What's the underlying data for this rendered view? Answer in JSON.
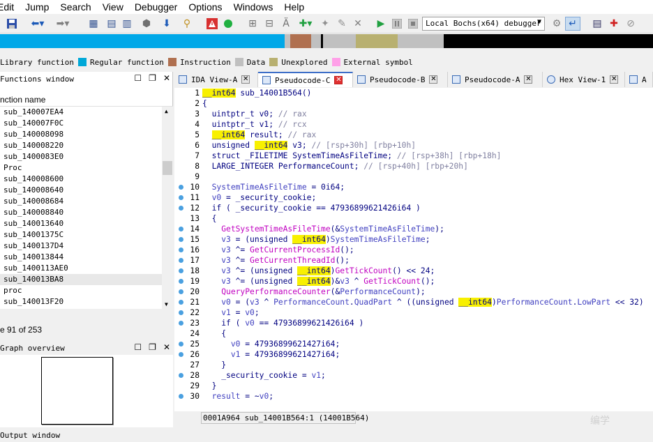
{
  "menu": [
    "Edit",
    "Jump",
    "Search",
    "View",
    "Debugger",
    "Options",
    "Windows",
    "Help"
  ],
  "debugger_select": "Local Bochs(x64) debugger",
  "legend": [
    {
      "label": "Library function",
      "color": "#00a8d8"
    },
    {
      "label": "Regular function",
      "color": "#b07050"
    },
    {
      "label": "Instruction",
      "color": "#c0c0c0"
    },
    {
      "label": "Data",
      "color": "#b8b070"
    },
    {
      "label": "Unexplored",
      "color": "#ffa0e8"
    },
    {
      "label": "External symbol",
      "color": ""
    }
  ],
  "functions_window": {
    "title": "Functions window",
    "column": "nction name",
    "rows": [
      "sub_140007EA4",
      "sub_140007F0C",
      "sub_140008098",
      "sub_140008220",
      "sub_1400083E0",
      "Proc",
      "sub_140008600",
      "sub_140008640",
      "sub_140008684",
      "sub_140008840",
      "sub_140013640",
      "sub_14001375C",
      "sub_1400137D4",
      "sub_140013844",
      "sub_1400113AE0",
      "sub_140013BA8",
      "proc",
      "sub_140013F20"
    ],
    "status": "e 91 of 253"
  },
  "graph_overview": {
    "title": "Graph overview"
  },
  "output_window": {
    "title": "Output window"
  },
  "tabs": [
    {
      "label": "IDA View-A"
    },
    {
      "label": "Pseudocode-C"
    },
    {
      "label": "Pseudocode-B"
    },
    {
      "label": "Pseudocode-A"
    },
    {
      "label": "Hex View-1"
    },
    {
      "label": "A"
    }
  ],
  "code_lines": [
    {
      "n": "1",
      "t": "__int64 sub_14001B564()"
    },
    {
      "n": "2",
      "t": "{"
    },
    {
      "n": "3",
      "t": "  uintptr_t v0; // rax"
    },
    {
      "n": "4",
      "t": "  uintptr_t v1; // rcx"
    },
    {
      "n": "5",
      "t": "  __int64 result; // rax"
    },
    {
      "n": "6",
      "t": "  unsigned __int64 v3; // [rsp+30h] [rbp+10h]"
    },
    {
      "n": "7",
      "t": "  struct _FILETIME SystemTimeAsFileTime; // [rsp+38h] [rbp+18h]"
    },
    {
      "n": "8",
      "t": "  LARGE_INTEGER PerformanceCount; // [rsp+40h] [rbp+20h]"
    },
    {
      "n": "9",
      "t": ""
    },
    {
      "n": "10",
      "t": "  SystemTimeAsFileTime = 0i64;"
    },
    {
      "n": "11",
      "t": "  v0 = _security_cookie;"
    },
    {
      "n": "12",
      "t": "  if ( _security_cookie == 47936899621426i64 )"
    },
    {
      "n": "13",
      "t": "  {"
    },
    {
      "n": "14",
      "t": "    GetSystemTimeAsFileTime(&SystemTimeAsFileTime);"
    },
    {
      "n": "15",
      "t": "    v3 = (unsigned __int64)SystemTimeAsFileTime;"
    },
    {
      "n": "16",
      "t": "    v3 ^= GetCurrentProcessId();"
    },
    {
      "n": "17",
      "t": "    v3 ^= GetCurrentThreadId();"
    },
    {
      "n": "18",
      "t": "    v3 ^= (unsigned __int64)GetTickCount() << 24;"
    },
    {
      "n": "19",
      "t": "    v3 ^= (unsigned __int64)&v3 ^ GetTickCount();"
    },
    {
      "n": "20",
      "t": "    QueryPerformanceCounter(&PerformanceCount);"
    },
    {
      "n": "21",
      "t": "    v0 = (v3 ^ PerformanceCount.QuadPart ^ ((unsigned __int64)PerformanceCount.LowPart << 32)"
    },
    {
      "n": "22",
      "t": "    v1 = v0;"
    },
    {
      "n": "23",
      "t": "    if ( v0 == 47936899621426i64 )"
    },
    {
      "n": "24",
      "t": "    {"
    },
    {
      "n": "25",
      "t": "      v0 = 47936899621427i64;"
    },
    {
      "n": "26",
      "t": "      v1 = 47936899621427i64;"
    },
    {
      "n": "27",
      "t": "    }"
    },
    {
      "n": "28",
      "t": "    _security_cookie = v1;"
    },
    {
      "n": "29",
      "t": "  }"
    },
    {
      "n": "30",
      "t": "  result = ~v0;"
    }
  ],
  "code_status": "0001A964 sub_14001B564:1 (14001B564)",
  "watermark": "编学"
}
